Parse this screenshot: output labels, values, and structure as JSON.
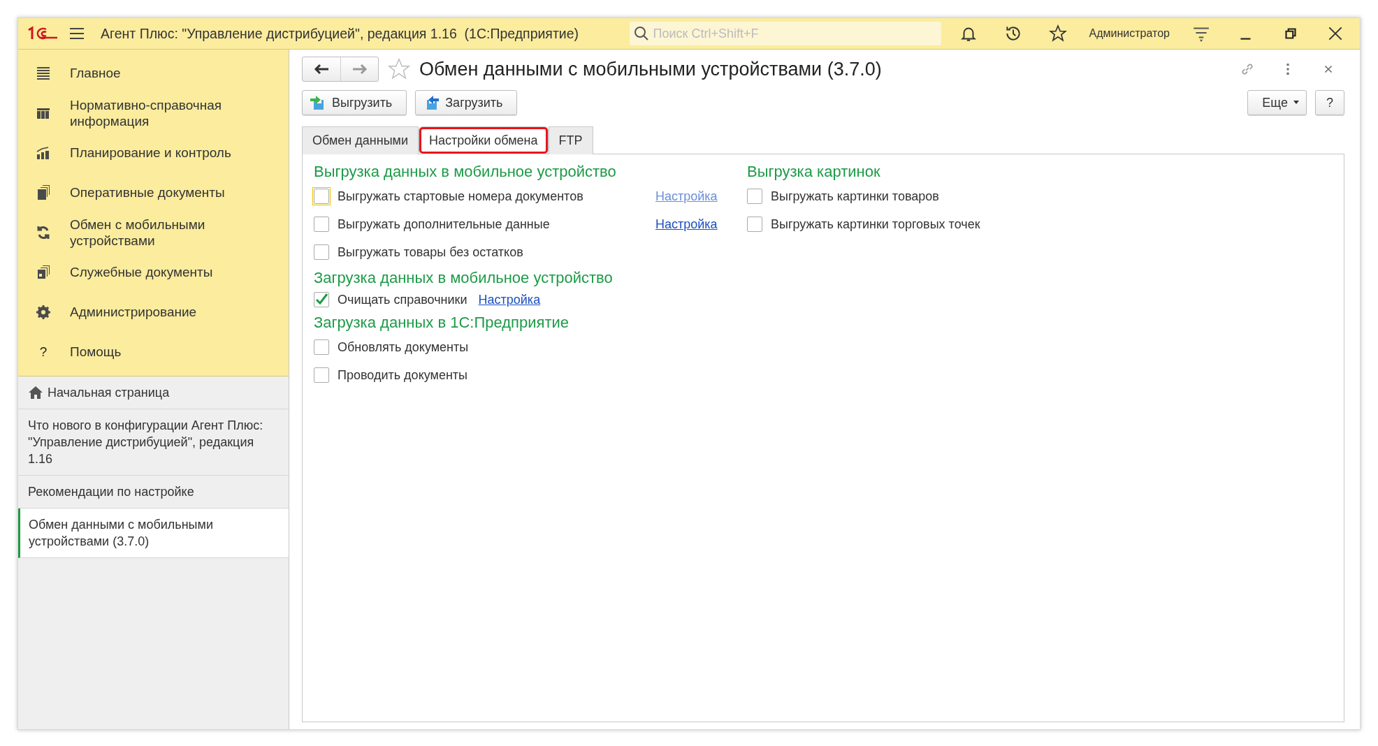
{
  "window": {
    "title": "Агент Плюс: \"Управление дистрибуцией\", редакция 1.16  (1С:Предприятие)",
    "search": {
      "placeholder": "Поиск Ctrl+Shift+F"
    },
    "user": "Администратор"
  },
  "sidebar": {
    "sections": [
      {
        "label": "Главное"
      },
      {
        "label": "Нормативно-справочная информация"
      },
      {
        "label": "Планирование и контроль"
      },
      {
        "label": "Оперативные документы"
      },
      {
        "label": "Обмен с мобильными устройствами"
      },
      {
        "label": "Служебные документы"
      },
      {
        "label": "Администрирование"
      },
      {
        "label": "Помощь",
        "glyph": "?"
      }
    ],
    "open_pages": [
      {
        "label": "Начальная страница",
        "kind": "home",
        "selected": false
      },
      {
        "label": "Что нового в конфигурации Агент Плюс: \"Управление дистрибуцией\", редакция 1.16",
        "kind": "page",
        "selected": false
      },
      {
        "label": "Рекомендации по настройке",
        "kind": "page",
        "selected": false
      },
      {
        "label": "Обмен данными с мобильными устройствами (3.7.0)",
        "kind": "page",
        "selected": true
      }
    ]
  },
  "form": {
    "title": "Обмен данными с мобильными устройствами (3.7.0)",
    "buttons": [
      {
        "label": "Выгрузить",
        "kind": "export"
      },
      {
        "label": "Загрузить",
        "kind": "import"
      }
    ],
    "more": "Еще",
    "help": "?",
    "tabs": [
      {
        "label": "Обмен данными",
        "selected": false,
        "highlighted": false
      },
      {
        "label": "Настройки обмена",
        "selected": true,
        "highlighted": true
      },
      {
        "label": "FTP",
        "selected": false,
        "highlighted": false
      }
    ],
    "columns": [
      {
        "groups": [
          {
            "title": "Выгрузка данных в мобильное устройство",
            "items": [
              {
                "label": "Выгружать стартовые номера документов",
                "checked": false,
                "focused": true,
                "link": "Настройка",
                "link_visited": true
              },
              {
                "label": "Выгружать дополнительные данные",
                "checked": false,
                "link": "Настройка",
                "link_visited": false
              },
              {
                "label": "Выгружать товары без остатков",
                "checked": false
              }
            ]
          },
          {
            "title": "Загрузка данных в мобильное устройство",
            "items": [
              {
                "label": "Очищать справочники",
                "checked": true,
                "link": "Настройка",
                "link_visited": false
              }
            ]
          },
          {
            "title": "Загрузка данных в 1С:Предприятие",
            "items": [
              {
                "label": "Обновлять документы",
                "checked": false
              },
              {
                "label": "Проводить документы",
                "checked": false
              }
            ]
          }
        ]
      },
      {
        "groups": [
          {
            "title": "Выгрузка картинок",
            "items": [
              {
                "label": "Выгружать картинки товаров",
                "checked": false
              },
              {
                "label": "Выгружать картинки торговых точек",
                "checked": false
              }
            ]
          }
        ]
      }
    ]
  }
}
